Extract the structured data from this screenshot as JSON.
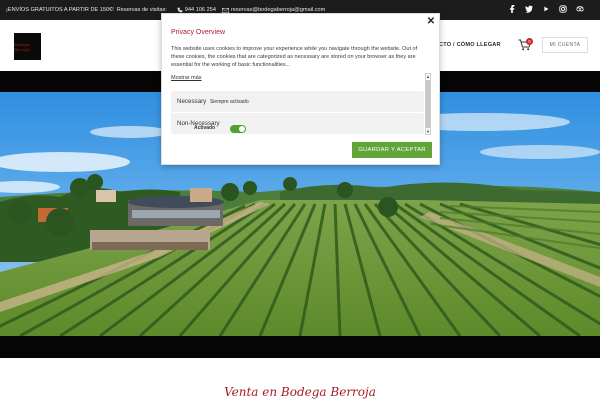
{
  "topbar": {
    "promo": "¡ENVÍOS GRATUITOS A PARTIR DE 150€!",
    "visit": "Reservas de visitas:",
    "phone": "944 106 254",
    "email": "reservas@bodegaberroja@gmail.com",
    "social_icons": [
      "facebook-icon",
      "twitter-icon",
      "youtube-icon",
      "instagram-icon",
      "tripadvisor-icon"
    ]
  },
  "header": {
    "logo_text": "Bodega Berroja",
    "nav_item": "CTO / CÓMO LLEGAR",
    "cart_count": "0",
    "account_label": "MI CUENTA"
  },
  "modal": {
    "title": "Privacy Overview",
    "text": "This website uses cookies to improve your experience while you navigate through the website. Out of these cookies, the cookies that are categorized as necessary are stored on your browser as they are essential for the working of basic functionalities...",
    "more_link": "Mostrar más",
    "necessary_label": "Necessary",
    "necessary_state": "Siempre activado",
    "nonnecessary_label": "Non-Necessary",
    "nonnecessary_state": "Activado",
    "close_icon": "close-icon",
    "accept_button": "GUARDAR Y ACEPTAR"
  },
  "section": {
    "title": "Venta en Bodega Berroja"
  },
  "colors": {
    "accent_red": "#b01c2c",
    "accept_green": "#61a53a",
    "topbar_bg": "#1c1c1c"
  }
}
